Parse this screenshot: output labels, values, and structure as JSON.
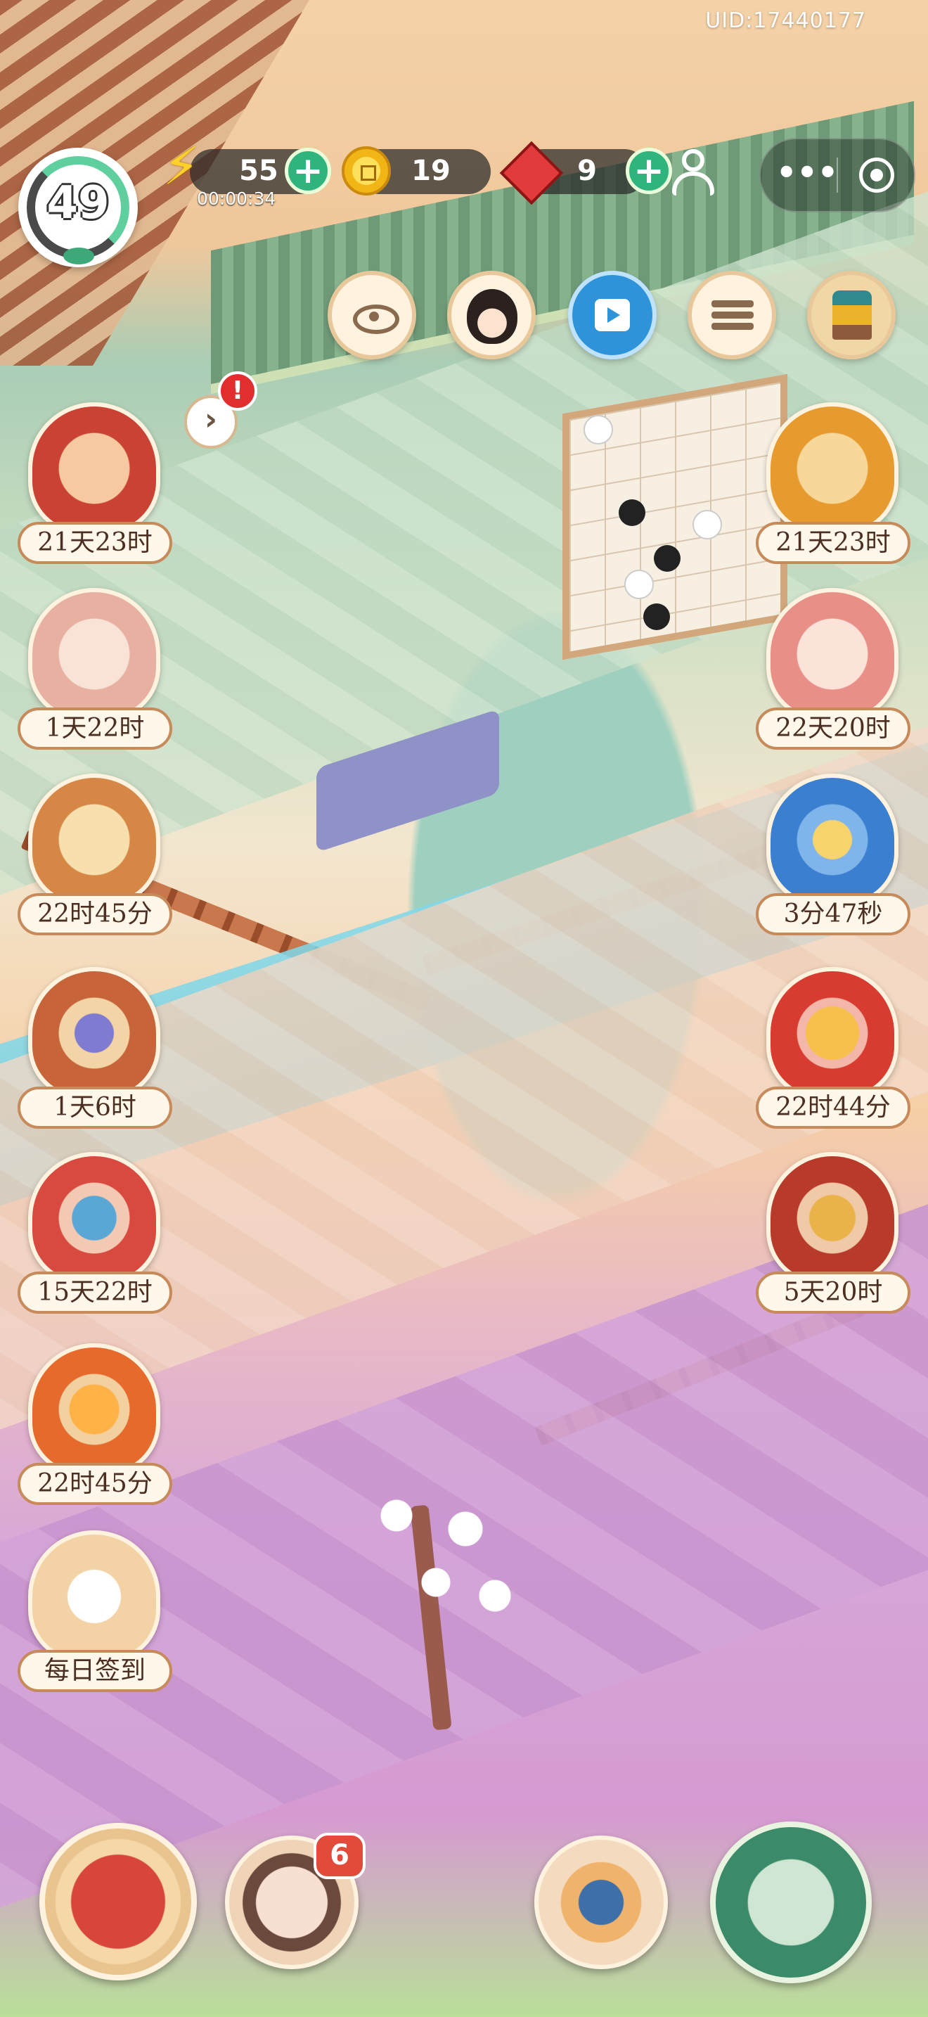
{
  "header": {
    "uid": "UID:17440177",
    "level": "49",
    "energy": {
      "value": "55",
      "timer": "00:00:34"
    },
    "coins": {
      "value": "19"
    },
    "gems": {
      "value": "9"
    }
  },
  "top_buttons": [
    "eye-icon",
    "avatar",
    "video-icon",
    "list-icon",
    "shrine-icon"
  ],
  "events_left": [
    {
      "label": "21天23时",
      "icon": "book-bundle-icon",
      "color": "#c94234"
    },
    {
      "label": "1天22时",
      "icon": "lion-cub-icon",
      "color": "#e7b0a0"
    },
    {
      "label": "22时45分",
      "icon": "horse-icon",
      "color": "#d68745"
    },
    {
      "label": "1天6时",
      "icon": "gift-box-5-icon",
      "color": "#c7643a"
    },
    {
      "label": "15天22时",
      "icon": "fan-fish-icon",
      "color": "#d8493f"
    },
    {
      "label": "22时45分",
      "icon": "dragon-orb-icon",
      "color": "#e56a2b"
    },
    {
      "label": "每日签到",
      "icon": "daily-signin-icon",
      "color": "#f3d3a6"
    }
  ],
  "events_right": [
    {
      "label": "21天23时",
      "icon": "scroll-question-icon",
      "color": "#e79b2f"
    },
    {
      "label": "22天20时",
      "icon": "tiger-cub-icon",
      "color": "#e88f87"
    },
    {
      "label": "3分47秒",
      "icon": "dragon-card-icon",
      "color": "#3b7fd0"
    },
    {
      "label": "22时44分",
      "icon": "treasure-chest-icon",
      "color": "#d83b2f"
    },
    {
      "label": "5天20时",
      "icon": "red-chest-icon",
      "color": "#b83a2a"
    }
  ],
  "bottom": {
    "notification_count": "6"
  }
}
